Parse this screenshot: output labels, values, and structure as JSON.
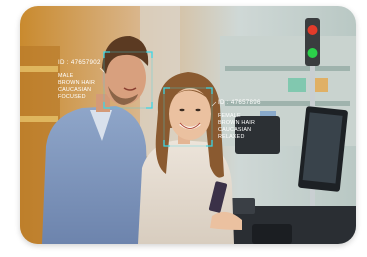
{
  "scene": {
    "subject": "Man and woman at store self-checkout with face recognition overlays",
    "colors": {
      "face_box": "#3ad6e6",
      "overlay_text": "#ffffff",
      "traffic_red": "#e23b2a",
      "traffic_green": "#2bd14a"
    }
  },
  "detections": [
    {
      "id": "ID : 47657902",
      "attributes": [
        "MALE",
        "BROWN HAIR",
        "CAUCASIAN",
        "FOCUSED"
      ]
    },
    {
      "id": "ID : 47657896",
      "attributes": [
        "FEMALE",
        "BROWN HAIR",
        "CAUCASIAN",
        "RELAXED"
      ]
    }
  ]
}
